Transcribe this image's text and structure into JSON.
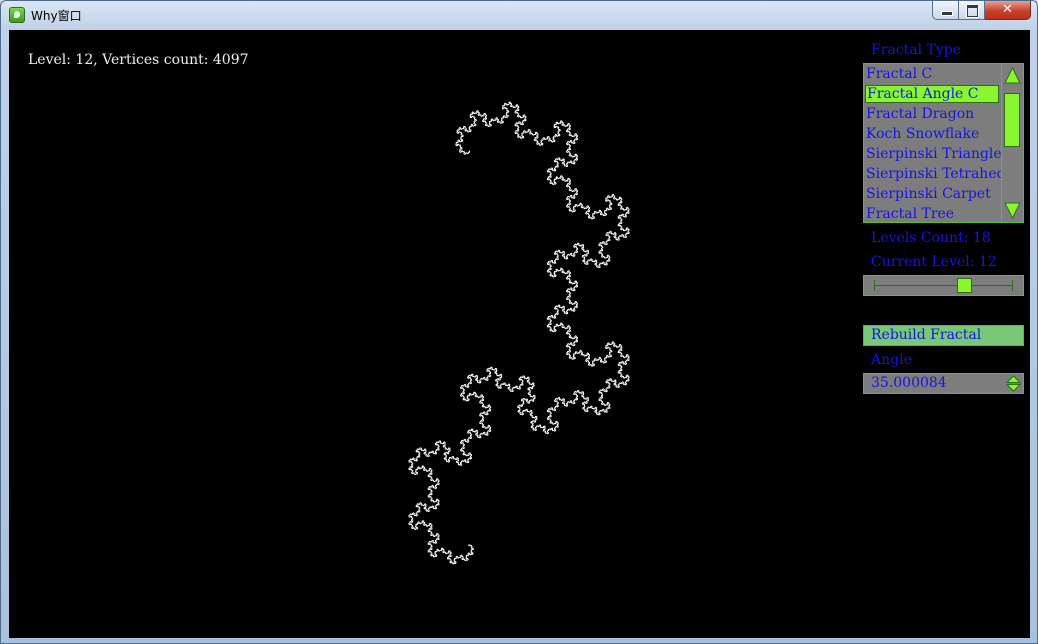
{
  "window": {
    "title": "Why窗口",
    "app_icon": "leaf-app-icon",
    "controls": {
      "minimize": "minimize-icon",
      "maximize": "maximize-icon",
      "close": "✕"
    }
  },
  "colors": {
    "canvas_bg": "#000000",
    "fractal_stroke": "#ffffff",
    "panel_text": "#1414e6",
    "panel_bg": "#7d7d7d",
    "accent_green": "#89f62e",
    "border_green": "#55c22c",
    "button_bg": "#78c878"
  },
  "hud": {
    "status": "Level: 12, Vertices count: 4097"
  },
  "panel": {
    "fractal_type_label": "Fractal Type",
    "fractal_types": [
      "Fractal C",
      "Fractal Angle C",
      "Fractal Dragon",
      "Koch Snowflake",
      "Sierpinski Triangle",
      "Sierpinski Tetrahedron",
      "Sierpinski Carpet",
      "Fractal Tree"
    ],
    "selected_type": "Fractal Angle C",
    "levels_count_label": "Levels Count: 18",
    "current_level_label": "Current Level: 12",
    "levels_count": 18,
    "current_level": 12,
    "rebuild_button": "Rebuild Fractal",
    "angle_label": "Angle",
    "angle_value": "35.000084"
  },
  "fractal": {
    "type": "angle-c-curve",
    "level": 12,
    "angle_deg": 35.000084
  }
}
